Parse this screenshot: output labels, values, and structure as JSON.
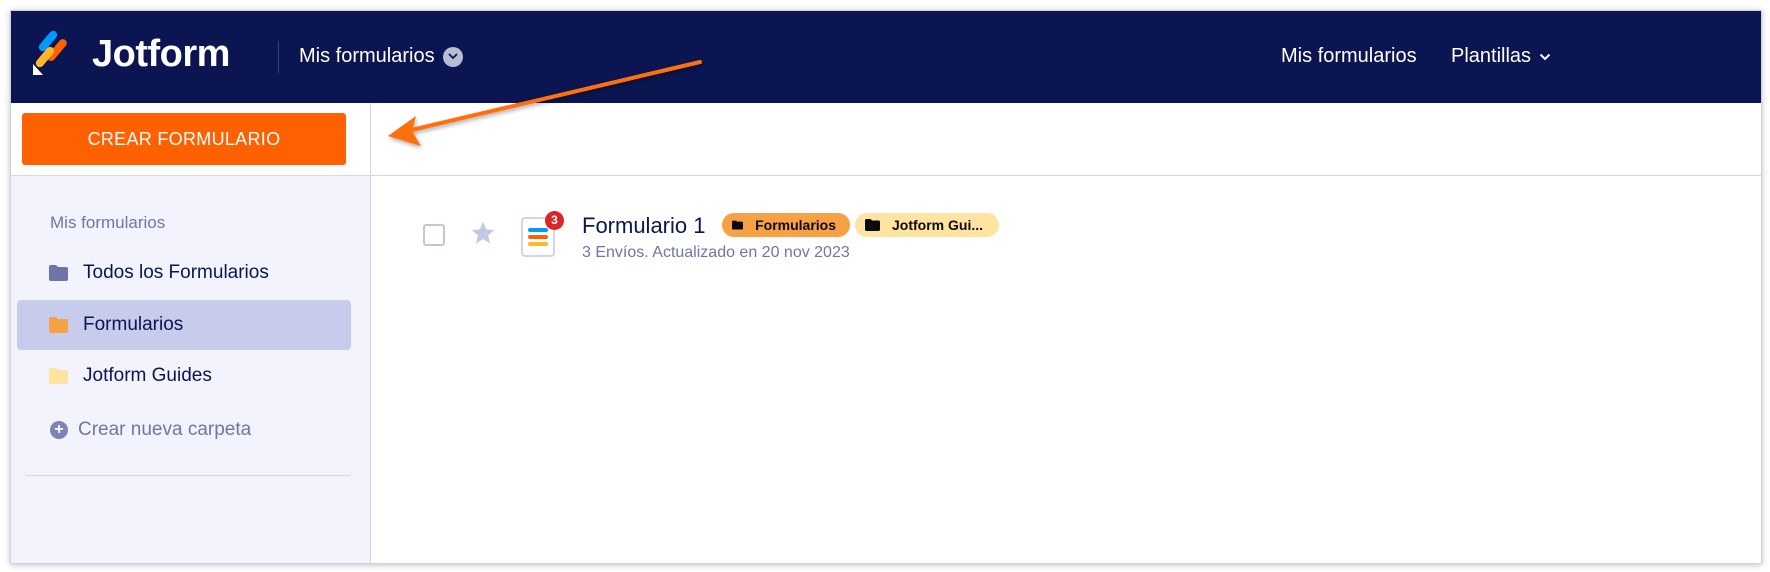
{
  "app": {
    "logo_text": "Jotform"
  },
  "header": {
    "workspace_label": "Mis formularios",
    "nav": [
      {
        "label": "Mis formularios"
      },
      {
        "label": "Plantillas"
      }
    ],
    "bg_color": "#0a1551"
  },
  "toolbar": {
    "create_label": "CREAR FORMULARIO",
    "create_color": "#ff6100"
  },
  "sidebar": {
    "heading": "Mis formularios",
    "items": [
      {
        "label": "Todos los Formularios",
        "icon": "folder-icon",
        "color": "#6f76a7",
        "active": false
      },
      {
        "label": "Formularios",
        "icon": "folder-icon",
        "color": "#f7a147",
        "active": true
      },
      {
        "label": "Jotform Guides",
        "icon": "folder-icon",
        "color": "#ffe3a1",
        "active": false
      }
    ],
    "new_folder_label": "Crear nueva carpeta"
  },
  "forms": [
    {
      "title": "Formulario 1",
      "meta": "3 Envíos. Actualizado en 20 nov 2023",
      "badge": "3",
      "tags": [
        {
          "label": "Formularios",
          "color": "#f7a147"
        },
        {
          "label": "Jotform Gui...",
          "color": "#ffe3a1"
        }
      ]
    }
  ],
  "annotation": {
    "arrow_color": "#ff6f0f",
    "points_to": "create-form-button"
  }
}
